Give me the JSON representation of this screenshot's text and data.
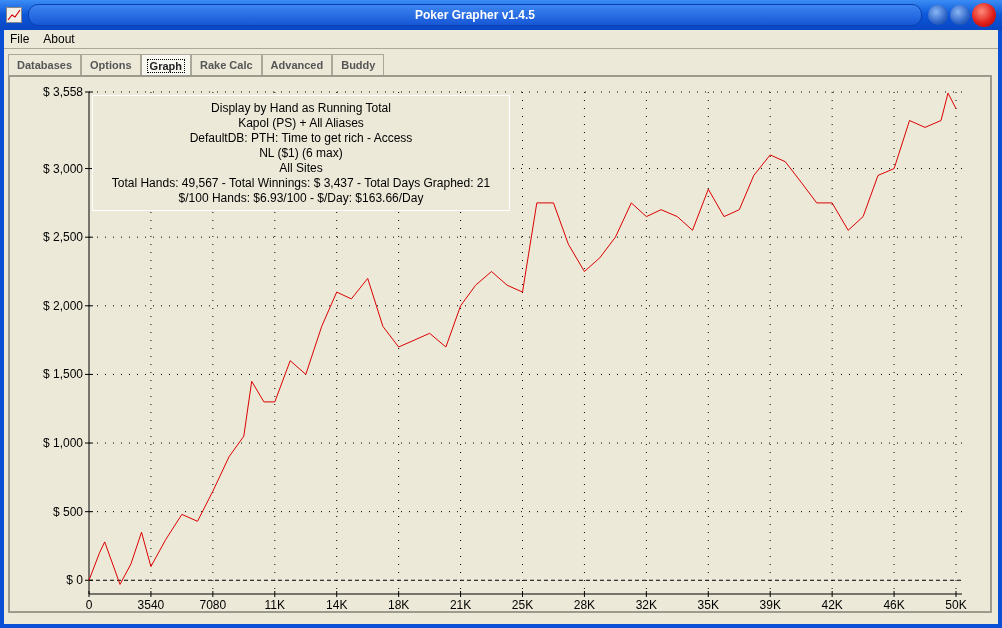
{
  "window": {
    "title": "Poker Grapher v1.4.5"
  },
  "menu": [
    {
      "label": "File"
    },
    {
      "label": "About"
    }
  ],
  "tabs": [
    {
      "label": "Databases",
      "selected": false
    },
    {
      "label": "Options",
      "selected": false
    },
    {
      "label": "Graph",
      "selected": true
    },
    {
      "label": "Rake Calc",
      "selected": false
    },
    {
      "label": "Advanced",
      "selected": false
    },
    {
      "label": "Buddy",
      "selected": false
    }
  ],
  "graph": {
    "info_lines": [
      "Display by Hand as Running Total",
      "Kapol (PS) + All Aliases",
      "DefaultDB: PTH: Time to get rich - Access",
      "NL ($1) (6 max)",
      "All Sites",
      "Total Hands: 49,567 - Total Winnings: $ 3,437 - Total Days Graphed: 21",
      "$/100 Hands: $6.93/100 - $/Day: $163.66/Day"
    ],
    "chart_data": {
      "type": "line",
      "x": [
        0,
        600,
        900,
        1770,
        2400,
        3000,
        3540,
        4400,
        5310,
        6200,
        7080,
        8000,
        8850,
        9300,
        10000,
        10620,
        11500,
        12390,
        13300,
        14160,
        15000,
        15930,
        16800,
        17700,
        18600,
        19470,
        20400,
        21240,
        22100,
        23010,
        23900,
        24780,
        25600,
        26550,
        27400,
        28320,
        29200,
        30090,
        31000,
        31860,
        32700,
        33630,
        34500,
        35400,
        36300,
        37170,
        38000,
        38940,
        39800,
        40710,
        41600,
        42480,
        43400,
        44250,
        45100,
        46020,
        46900,
        47790,
        48700,
        49100,
        49560
      ],
      "series": [
        {
          "color": "#dd0000",
          "values": [
            0,
            200,
            280,
            -30,
            120,
            350,
            100,
            300,
            480,
            430,
            650,
            900,
            1050,
            1450,
            1300,
            1300,
            1600,
            1500,
            1850,
            2100,
            2050,
            2200,
            1850,
            1700,
            1750,
            1800,
            1700,
            2000,
            2150,
            2250,
            2150,
            2100,
            2750,
            2750,
            2450,
            2250,
            2350,
            2500,
            2750,
            2650,
            2700,
            2650,
            2550,
            2850,
            2650,
            2700,
            2950,
            3100,
            3050,
            2900,
            2750,
            2750,
            2550,
            2650,
            2950,
            3000,
            3350,
            3300,
            3350,
            3550,
            3437
          ]
        }
      ],
      "grid": true,
      "xlim": [
        0,
        49560
      ],
      "ylim": [
        -100,
        3558
      ],
      "xticks": [
        {
          "value": 0,
          "label": "0"
        },
        {
          "value": 3540,
          "label": "3540"
        },
        {
          "value": 7080,
          "label": "7080"
        },
        {
          "value": 10620,
          "label": "11K"
        },
        {
          "value": 14160,
          "label": "14K"
        },
        {
          "value": 17700,
          "label": "18K"
        },
        {
          "value": 21240,
          "label": "21K"
        },
        {
          "value": 24780,
          "label": "25K"
        },
        {
          "value": 28320,
          "label": "28K"
        },
        {
          "value": 31860,
          "label": "32K"
        },
        {
          "value": 35400,
          "label": "35K"
        },
        {
          "value": 38940,
          "label": "39K"
        },
        {
          "value": 42480,
          "label": "42K"
        },
        {
          "value": 46020,
          "label": "46K"
        },
        {
          "value": 49560,
          "label": "50K"
        }
      ],
      "yticks": [
        {
          "value": 0,
          "label": "$ 0"
        },
        {
          "value": 500,
          "label": "$ 500"
        },
        {
          "value": 1000,
          "label": "$ 1,000"
        },
        {
          "value": 1500,
          "label": "$ 1,500"
        },
        {
          "value": 2000,
          "label": "$ 2,000"
        },
        {
          "value": 2500,
          "label": "$ 2,500"
        },
        {
          "value": 3000,
          "label": "$ 3,000"
        },
        {
          "value": 3558,
          "label": "$ 3,558"
        }
      ]
    }
  }
}
